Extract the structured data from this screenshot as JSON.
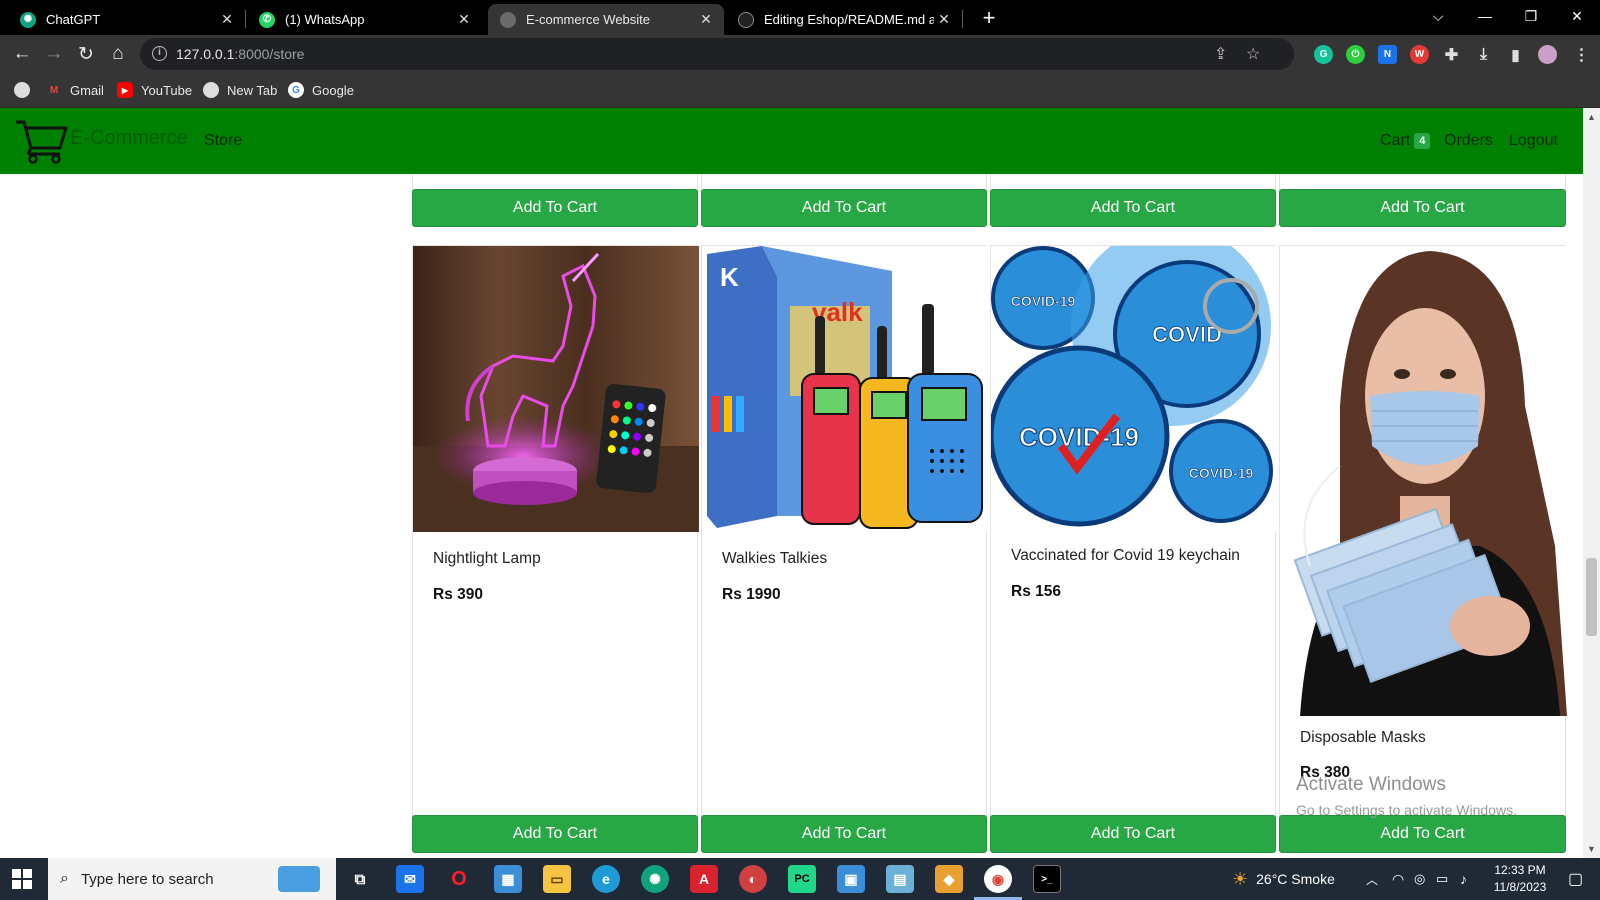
{
  "browser": {
    "tabs": [
      {
        "title": "ChatGPT",
        "active": false
      },
      {
        "title": "(1) WhatsApp",
        "active": false
      },
      {
        "title": "E-commerce Website",
        "active": true
      },
      {
        "title": "Editing Eshop/README.md at m",
        "active": false
      }
    ],
    "url_host": "127.0.0.1",
    "url_path": ":8000/store",
    "bookmarks": [
      "Gmail",
      "YouTube",
      "New Tab",
      "Google"
    ]
  },
  "site": {
    "brand": "E-Commerce",
    "nav_store": "Store",
    "nav_cart": "Cart",
    "cart_count": "4",
    "nav_orders": "Orders",
    "nav_logout": "Logout",
    "add_to_cart": "Add To Cart",
    "products": [
      {
        "name": "Nightlight Lamp",
        "price": "Rs 390"
      },
      {
        "name": "Walkies Talkies",
        "price": "Rs 1990"
      },
      {
        "name": "Vaccinated for Covid 19 keychain",
        "price": "Rs 156"
      },
      {
        "name": "Disposable Masks",
        "price": "Rs 380"
      }
    ]
  },
  "watermark": {
    "line1": "Activate Windows",
    "line2": "Go to Settings to activate Windows."
  },
  "taskbar": {
    "search_placeholder": "Type here to search",
    "weather": "26°C  Smoke",
    "time": "12:33 PM",
    "date": "11/8/2023"
  },
  "colors": {
    "navbar": "#008000",
    "button": "#28a745",
    "tab_strip": "#000000",
    "toolbar": "#353535",
    "taskbar": "#1f2a36"
  }
}
